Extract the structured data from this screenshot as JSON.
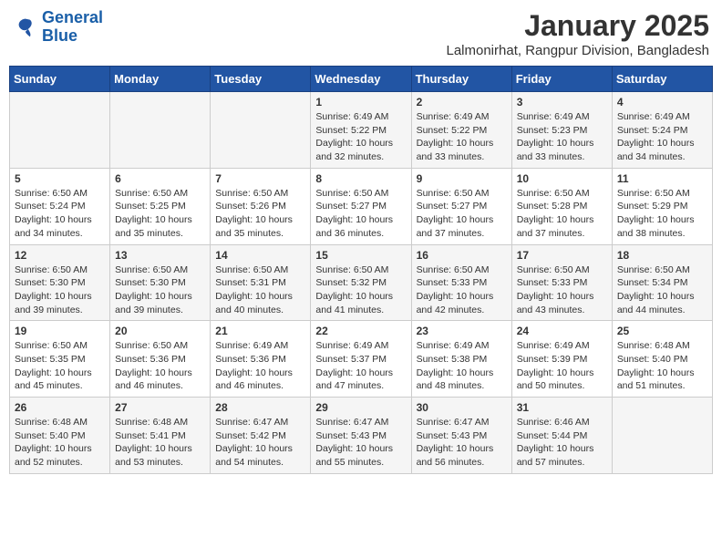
{
  "logo": {
    "line1": "General",
    "line2": "Blue"
  },
  "title": "January 2025",
  "subtitle": "Lalmonirhat, Rangpur Division, Bangladesh",
  "headers": [
    "Sunday",
    "Monday",
    "Tuesday",
    "Wednesday",
    "Thursday",
    "Friday",
    "Saturday"
  ],
  "weeks": [
    [
      {
        "day": "",
        "info": ""
      },
      {
        "day": "",
        "info": ""
      },
      {
        "day": "",
        "info": ""
      },
      {
        "day": "1",
        "info": "Sunrise: 6:49 AM\nSunset: 5:22 PM\nDaylight: 10 hours\nand 32 minutes."
      },
      {
        "day": "2",
        "info": "Sunrise: 6:49 AM\nSunset: 5:22 PM\nDaylight: 10 hours\nand 33 minutes."
      },
      {
        "day": "3",
        "info": "Sunrise: 6:49 AM\nSunset: 5:23 PM\nDaylight: 10 hours\nand 33 minutes."
      },
      {
        "day": "4",
        "info": "Sunrise: 6:49 AM\nSunset: 5:24 PM\nDaylight: 10 hours\nand 34 minutes."
      }
    ],
    [
      {
        "day": "5",
        "info": "Sunrise: 6:50 AM\nSunset: 5:24 PM\nDaylight: 10 hours\nand 34 minutes."
      },
      {
        "day": "6",
        "info": "Sunrise: 6:50 AM\nSunset: 5:25 PM\nDaylight: 10 hours\nand 35 minutes."
      },
      {
        "day": "7",
        "info": "Sunrise: 6:50 AM\nSunset: 5:26 PM\nDaylight: 10 hours\nand 35 minutes."
      },
      {
        "day": "8",
        "info": "Sunrise: 6:50 AM\nSunset: 5:27 PM\nDaylight: 10 hours\nand 36 minutes."
      },
      {
        "day": "9",
        "info": "Sunrise: 6:50 AM\nSunset: 5:27 PM\nDaylight: 10 hours\nand 37 minutes."
      },
      {
        "day": "10",
        "info": "Sunrise: 6:50 AM\nSunset: 5:28 PM\nDaylight: 10 hours\nand 37 minutes."
      },
      {
        "day": "11",
        "info": "Sunrise: 6:50 AM\nSunset: 5:29 PM\nDaylight: 10 hours\nand 38 minutes."
      }
    ],
    [
      {
        "day": "12",
        "info": "Sunrise: 6:50 AM\nSunset: 5:30 PM\nDaylight: 10 hours\nand 39 minutes."
      },
      {
        "day": "13",
        "info": "Sunrise: 6:50 AM\nSunset: 5:30 PM\nDaylight: 10 hours\nand 39 minutes."
      },
      {
        "day": "14",
        "info": "Sunrise: 6:50 AM\nSunset: 5:31 PM\nDaylight: 10 hours\nand 40 minutes."
      },
      {
        "day": "15",
        "info": "Sunrise: 6:50 AM\nSunset: 5:32 PM\nDaylight: 10 hours\nand 41 minutes."
      },
      {
        "day": "16",
        "info": "Sunrise: 6:50 AM\nSunset: 5:33 PM\nDaylight: 10 hours\nand 42 minutes."
      },
      {
        "day": "17",
        "info": "Sunrise: 6:50 AM\nSunset: 5:33 PM\nDaylight: 10 hours\nand 43 minutes."
      },
      {
        "day": "18",
        "info": "Sunrise: 6:50 AM\nSunset: 5:34 PM\nDaylight: 10 hours\nand 44 minutes."
      }
    ],
    [
      {
        "day": "19",
        "info": "Sunrise: 6:50 AM\nSunset: 5:35 PM\nDaylight: 10 hours\nand 45 minutes."
      },
      {
        "day": "20",
        "info": "Sunrise: 6:50 AM\nSunset: 5:36 PM\nDaylight: 10 hours\nand 46 minutes."
      },
      {
        "day": "21",
        "info": "Sunrise: 6:49 AM\nSunset: 5:36 PM\nDaylight: 10 hours\nand 46 minutes."
      },
      {
        "day": "22",
        "info": "Sunrise: 6:49 AM\nSunset: 5:37 PM\nDaylight: 10 hours\nand 47 minutes."
      },
      {
        "day": "23",
        "info": "Sunrise: 6:49 AM\nSunset: 5:38 PM\nDaylight: 10 hours\nand 48 minutes."
      },
      {
        "day": "24",
        "info": "Sunrise: 6:49 AM\nSunset: 5:39 PM\nDaylight: 10 hours\nand 50 minutes."
      },
      {
        "day": "25",
        "info": "Sunrise: 6:48 AM\nSunset: 5:40 PM\nDaylight: 10 hours\nand 51 minutes."
      }
    ],
    [
      {
        "day": "26",
        "info": "Sunrise: 6:48 AM\nSunset: 5:40 PM\nDaylight: 10 hours\nand 52 minutes."
      },
      {
        "day": "27",
        "info": "Sunrise: 6:48 AM\nSunset: 5:41 PM\nDaylight: 10 hours\nand 53 minutes."
      },
      {
        "day": "28",
        "info": "Sunrise: 6:47 AM\nSunset: 5:42 PM\nDaylight: 10 hours\nand 54 minutes."
      },
      {
        "day": "29",
        "info": "Sunrise: 6:47 AM\nSunset: 5:43 PM\nDaylight: 10 hours\nand 55 minutes."
      },
      {
        "day": "30",
        "info": "Sunrise: 6:47 AM\nSunset: 5:43 PM\nDaylight: 10 hours\nand 56 minutes."
      },
      {
        "day": "31",
        "info": "Sunrise: 6:46 AM\nSunset: 5:44 PM\nDaylight: 10 hours\nand 57 minutes."
      },
      {
        "day": "",
        "info": ""
      }
    ]
  ]
}
